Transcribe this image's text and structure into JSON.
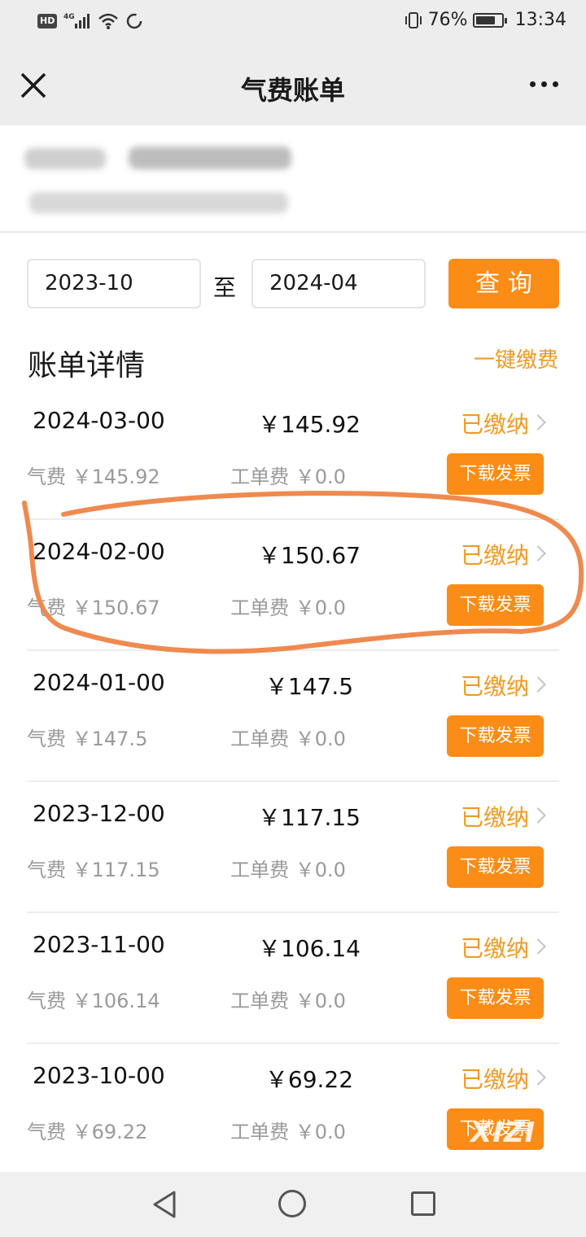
{
  "status_bar": {
    "hd_badge": "HD",
    "network": "4G",
    "battery_percent": "76%",
    "battery_level": 0.76,
    "time": "13:34"
  },
  "nav": {
    "title": "气费账单",
    "close_icon": "close-icon",
    "more_icon": "more-icon"
  },
  "query": {
    "start_date": "2023-10",
    "separator": "至",
    "end_date": "2024-04",
    "button_label": "查询"
  },
  "section": {
    "title": "账单详情",
    "one_click_pay": "一键缴费"
  },
  "bills": [
    {
      "date": "2024-03-00",
      "amount": "￥145.92",
      "status": "已缴纳",
      "gas_fee": "气费 ￥145.92",
      "work_fee": "工单费 ￥0.0",
      "invoice_label": "下载发票"
    },
    {
      "date": "2024-02-00",
      "amount": "￥150.67",
      "status": "已缴纳",
      "gas_fee": "气费 ￥150.67",
      "work_fee": "工单费 ￥0.0",
      "invoice_label": "下载发票"
    },
    {
      "date": "2024-01-00",
      "amount": "￥147.5",
      "status": "已缴纳",
      "gas_fee": "气费 ￥147.5",
      "work_fee": "工单费 ￥0.0",
      "invoice_label": "下载发票"
    },
    {
      "date": "2023-12-00",
      "amount": "￥117.15",
      "status": "已缴纳",
      "gas_fee": "气费 ￥117.15",
      "work_fee": "工单费 ￥0.0",
      "invoice_label": "下载发票"
    },
    {
      "date": "2023-11-00",
      "amount": "￥106.14",
      "status": "已缴纳",
      "gas_fee": "气费 ￥106.14",
      "work_fee": "工单费 ￥0.0",
      "invoice_label": "下载发票"
    },
    {
      "date": "2023-10-00",
      "amount": "￥69.22",
      "status": "已缴纳",
      "gas_fee": "气费 ￥69.22",
      "work_fee": "工单费 ￥0.0",
      "invoice_label": "下载发票"
    }
  ],
  "watermark": "XIZI",
  "colors": {
    "accent": "#fb8c15",
    "status_text": "#f09a22",
    "annotation": "#ef8a4f"
  }
}
